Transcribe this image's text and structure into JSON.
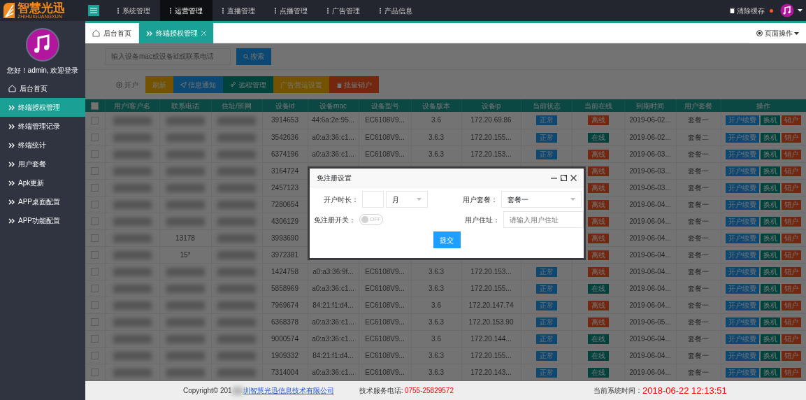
{
  "logo": {
    "title": "智慧光迅",
    "subtitle": "ZHIHUIGUANGXUN"
  },
  "top_menu": [
    {
      "label": "系统管理",
      "selected": false
    },
    {
      "label": "运营管理",
      "selected": true
    },
    {
      "label": "直播管理",
      "selected": false
    },
    {
      "label": "点播管理",
      "selected": false
    },
    {
      "label": "广告管理",
      "selected": false
    },
    {
      "label": "产品信息",
      "selected": false
    }
  ],
  "clear_cache": {
    "label": "清除缓存",
    "notification": true
  },
  "sidebar": {
    "greeting": "您好！admin, 欢迎登录",
    "items": [
      {
        "label": "后台首页",
        "kind": "home",
        "selected": false
      },
      {
        "label": "终端授权管理",
        "kind": "page",
        "selected": true
      },
      {
        "label": "终端管理记录",
        "kind": "page",
        "selected": false
      },
      {
        "label": "终端统计",
        "kind": "page",
        "selected": false
      },
      {
        "label": "用户套餐",
        "kind": "page",
        "selected": false
      },
      {
        "label": "Apk更新",
        "kind": "page",
        "selected": false
      },
      {
        "label": "APP桌面配置",
        "kind": "page",
        "selected": false
      },
      {
        "label": "APP功能配置",
        "kind": "page",
        "selected": false
      }
    ]
  },
  "page_tabs": [
    {
      "label": "后台首页",
      "kind": "home",
      "selected": false,
      "closable": false
    },
    {
      "label": "终端授权管理",
      "kind": "page",
      "selected": true,
      "closable": true
    }
  ],
  "page_actions": "页面操作",
  "search": {
    "placeholder": "输入设备mac或设备id或联系电话",
    "button": "搜索"
  },
  "toolbar": [
    {
      "label": "开户",
      "kind": "outline"
    },
    {
      "label": "刷新",
      "kind": "warm"
    },
    {
      "label": "信息通知",
      "kind": "blue"
    },
    {
      "label": "远程管理",
      "kind": "teal"
    },
    {
      "label": "广告营运设置",
      "kind": "warm"
    },
    {
      "label": "批量销户",
      "kind": "danger"
    }
  ],
  "table": {
    "select_all": false,
    "columns": [
      "用户/客户名",
      "联系电话",
      "住址/班网",
      "设备id",
      "设备mac",
      "设备型号",
      "设备版本",
      "设备ip",
      "当前状态",
      "当前在线",
      "到期时间",
      "用户套餐",
      "操作"
    ],
    "rows": [
      {
        "checked": false,
        "device_id": "3914653",
        "mac": "44:6a:2e:95...",
        "model": "EC6108V9...",
        "version": "3.6",
        "ip": "172.20.69.86",
        "status": {
          "label": "正常",
          "kind": "normal"
        },
        "online": {
          "label": "离线",
          "kind": "offline"
        },
        "expiry": "2019-06-02...",
        "package": "套餐一",
        "actions": [
          "开户续费",
          "换机",
          "销户"
        ]
      },
      {
        "checked": false,
        "device_id": "3542636",
        "mac": "a0:a3:36:c1...",
        "model": "EC6108V9...",
        "version": "3.6.3",
        "ip": "172.20.155...",
        "status": {
          "label": "正常",
          "kind": "normal"
        },
        "online": {
          "label": "在线",
          "kind": "online"
        },
        "expiry": "2019-06-02...",
        "package": "套餐二",
        "actions": [
          "开户续费",
          "换机",
          "销户"
        ]
      },
      {
        "checked": false,
        "device_id": "6374196",
        "mac": "a0:a3:36:c1...",
        "model": "EC6108V9...",
        "version": "3.6.3",
        "ip": "172.20.153...",
        "status": {
          "label": "正常",
          "kind": "normal"
        },
        "online": {
          "label": "离线",
          "kind": "offline"
        },
        "expiry": "2019-06-03...",
        "package": "套餐一",
        "actions": [
          "开户续费",
          "换机",
          "销户"
        ]
      },
      {
        "checked": false,
        "device_id": "3164724",
        "online": {
          "label": "离线",
          "kind": "offline"
        },
        "expiry": "2019-06-03...",
        "package": "套餐一",
        "actions": [
          "开户续费",
          "换机",
          "销户"
        ]
      },
      {
        "checked": false,
        "device_id": "2457123",
        "online": {
          "label": "离线",
          "kind": "offline"
        },
        "expiry": "2019-06-03...",
        "package": "套餐一",
        "actions": [
          "开户续费",
          "换机",
          "销户"
        ]
      },
      {
        "checked": false,
        "device_id": "7280654",
        "online": {
          "label": "离线",
          "kind": "offline"
        },
        "expiry": "2019-06-04...",
        "package": "套餐一",
        "actions": [
          "开户续费",
          "换机",
          "销户"
        ]
      },
      {
        "checked": false,
        "device_id": "4306129",
        "online": {
          "label": "离线",
          "kind": "offline"
        },
        "expiry": "2019-06-04...",
        "package": "套餐一",
        "actions": [
          "开户续费",
          "换机",
          "销户"
        ]
      },
      {
        "checked": false,
        "phone": "13178",
        "device_id": "3993690",
        "online": {
          "label": "离线",
          "kind": "offline"
        },
        "expiry": "2019-06-04...",
        "package": "套餐一",
        "actions": [
          "开户续费",
          "换机",
          "销户"
        ]
      },
      {
        "checked": false,
        "phone": "15*",
        "device_id": "3972381",
        "online": {
          "label": "离线",
          "kind": "offline"
        },
        "expiry": "2019-06-04...",
        "package": "套餐一",
        "actions": [
          "开户续费",
          "换机",
          "销户"
        ]
      },
      {
        "checked": false,
        "device_id": "1424758",
        "mac": "a0:a3:36:9f...",
        "model": "EC6108V9...",
        "version": "3.6.3",
        "ip": "172.20.153...",
        "status": {
          "label": "正常",
          "kind": "normal"
        },
        "online": {
          "label": "离线",
          "kind": "offline"
        },
        "expiry": "2019-06-04...",
        "package": "套餐一",
        "actions": [
          "开户续费",
          "换机",
          "销户"
        ]
      },
      {
        "checked": false,
        "device_id": "5858969",
        "mac": "a0:a3:36:c1...",
        "model": "EC6108V9...",
        "version": "3.6.3",
        "ip": "172.20.155...",
        "status": {
          "label": "正常",
          "kind": "normal"
        },
        "online": {
          "label": "在线",
          "kind": "online"
        },
        "expiry": "2019-06-04...",
        "package": "套餐一",
        "actions": [
          "开户续费",
          "换机",
          "销户"
        ]
      },
      {
        "checked": false,
        "device_id": "7969674",
        "mac": "84:21:f1:d4...",
        "model": "EC6108V9...",
        "version": "3.6",
        "ip": "172.20.147.74",
        "status": {
          "label": "正常",
          "kind": "normal"
        },
        "online": {
          "label": "离线",
          "kind": "offline"
        },
        "expiry": "2019-06-04...",
        "package": "套餐一",
        "actions": [
          "开户续费",
          "换机",
          "销户"
        ]
      },
      {
        "checked": false,
        "device_id": "6368378",
        "mac": "a0:a3:36:c1...",
        "model": "EC6108V9...",
        "version": "3.6.3",
        "ip": "172.20.153.90",
        "status": {
          "label": "正常",
          "kind": "normal"
        },
        "online": {
          "label": "离线",
          "kind": "offline"
        },
        "expiry": "2019-06-05...",
        "package": "套餐一",
        "actions": [
          "开户续费",
          "换机",
          "销户"
        ]
      },
      {
        "checked": false,
        "device_id": "9000574",
        "mac": "a0:a3:36:c1...",
        "model": "EC6108V9...",
        "version": "3.6",
        "ip": "172.20.144...",
        "status": {
          "label": "正常",
          "kind": "normal"
        },
        "online": {
          "label": "在线",
          "kind": "online"
        },
        "expiry": "2019-06-04...",
        "package": "套餐一",
        "actions": [
          "开户续费",
          "换机",
          "销户"
        ]
      },
      {
        "checked": false,
        "device_id": "1909332",
        "mac": "84:21:f1:d4...",
        "model": "EC6108V9...",
        "version": "3.6.3",
        "ip": "172.20.155...",
        "status": {
          "label": "正常",
          "kind": "normal"
        },
        "online": {
          "label": "在线",
          "kind": "online"
        },
        "expiry": "2019-06-04...",
        "package": "套餐一",
        "actions": [
          "开户续费",
          "换机",
          "销户"
        ]
      },
      {
        "checked": false,
        "device_id": "7314004",
        "mac": "a0:a3:36:c1...",
        "model": "EC6108V9...",
        "version": "3.6.3",
        "ip": "172.20.143...",
        "status": {
          "label": "正常",
          "kind": "normal"
        },
        "online": {
          "label": "在线",
          "kind": "online"
        },
        "expiry": "2019-06-04...",
        "package": "套餐一",
        "actions": [
          "开户续费",
          "换机",
          "销户"
        ]
      }
    ]
  },
  "dialog": {
    "title": "免注册设置",
    "duration_label": "开户时长：",
    "duration_unit": "月",
    "package_label": "用户套餐：",
    "package_value": "套餐一",
    "toggle_label": "免注册开关：",
    "toggle": {
      "on": false,
      "off_text": "OFF"
    },
    "address_label": "用户住址：",
    "address_placeholder": "请输入用户住址",
    "submit": "提交"
  },
  "footer": {
    "copyright": "Copyright© 201",
    "company": "圳智慧光迅信息技术有限公司",
    "phone_label": "技术服务电话:",
    "phone": "0755-25829572",
    "time_label": "当前系统时间：",
    "time": "2018-06-22 12:13:51"
  }
}
